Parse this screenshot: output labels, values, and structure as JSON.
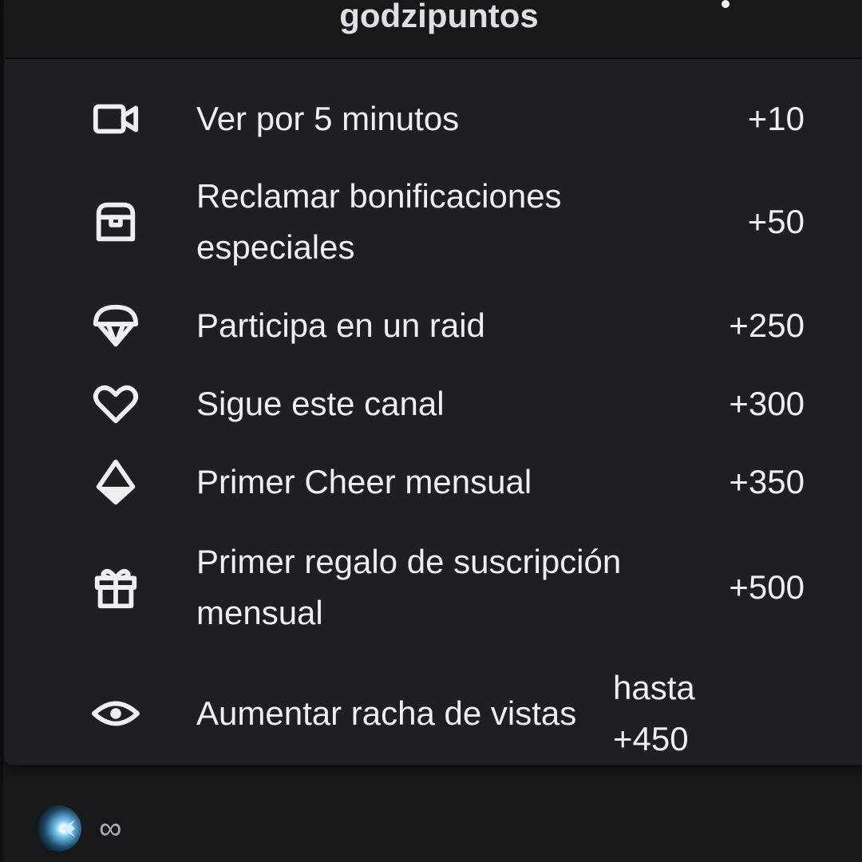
{
  "popover": {
    "title": "godzipuntos"
  },
  "rewards": [
    {
      "icon": "video-camera-icon",
      "label": "Ver por 5 minutos",
      "value": "+10"
    },
    {
      "icon": "treasure-chest-icon",
      "label": "Reclamar bonificaciones especiales",
      "value": "+50"
    },
    {
      "icon": "parachute-icon",
      "label": "Participa en un raid",
      "value": "+250"
    },
    {
      "icon": "heart-icon",
      "label": "Sigue este canal",
      "value": "+300"
    },
    {
      "icon": "bits-gem-icon",
      "label": "Primer Cheer mensual",
      "value": "+350"
    },
    {
      "icon": "gift-icon",
      "label": "Primer regalo de suscripción mensual",
      "value": "+500"
    },
    {
      "icon": "eye-icon",
      "label": "Aumentar racha de vistas",
      "value_line1": "hasta",
      "value_line2": "+450"
    }
  ],
  "footer": {
    "badge_icon": "channel-points-badge-icon",
    "balance": "∞"
  },
  "colors": {
    "background": "#18181b",
    "panel": "#1f1f23",
    "text": "#efeff1"
  }
}
